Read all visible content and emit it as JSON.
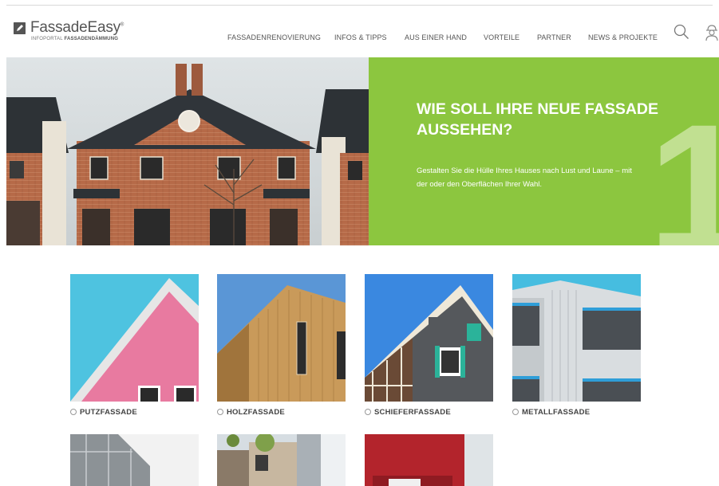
{
  "brand": {
    "name": "FassadeEasy",
    "trademark": "®",
    "subtitle_prefix": "INFOPORTAL",
    "subtitle_bold": "FASSADENDÄMMUNG",
    "logo_icon": "pencil-square-icon"
  },
  "nav": {
    "items": [
      {
        "label": "FASSADENRENOVIERUNG"
      },
      {
        "label": "INFOS & TIPPS"
      },
      {
        "label": "AUS EINER HAND"
      },
      {
        "label": "VORTEILE"
      },
      {
        "label": "PARTNER"
      },
      {
        "label": "NEWS & PROJEKTE"
      }
    ],
    "search_icon": "search-icon",
    "user_icon": "user-icon"
  },
  "hero": {
    "title": "WIE SOLL IHRE NEUE FASSADE AUSSEHEN?",
    "text": "Gestalten Sie die Hülle Ihres Hauses nach Lust und Laune – mit der oder den Oberflächen Ihrer Wahl.",
    "step_number": "1",
    "panel_color": "#8cc63f"
  },
  "facades": [
    {
      "label": "PUTZFASSADE"
    },
    {
      "label": "HOLZFASSADE"
    },
    {
      "label": "SCHIEFERFASSADE"
    },
    {
      "label": "METALLFASSADE"
    }
  ]
}
